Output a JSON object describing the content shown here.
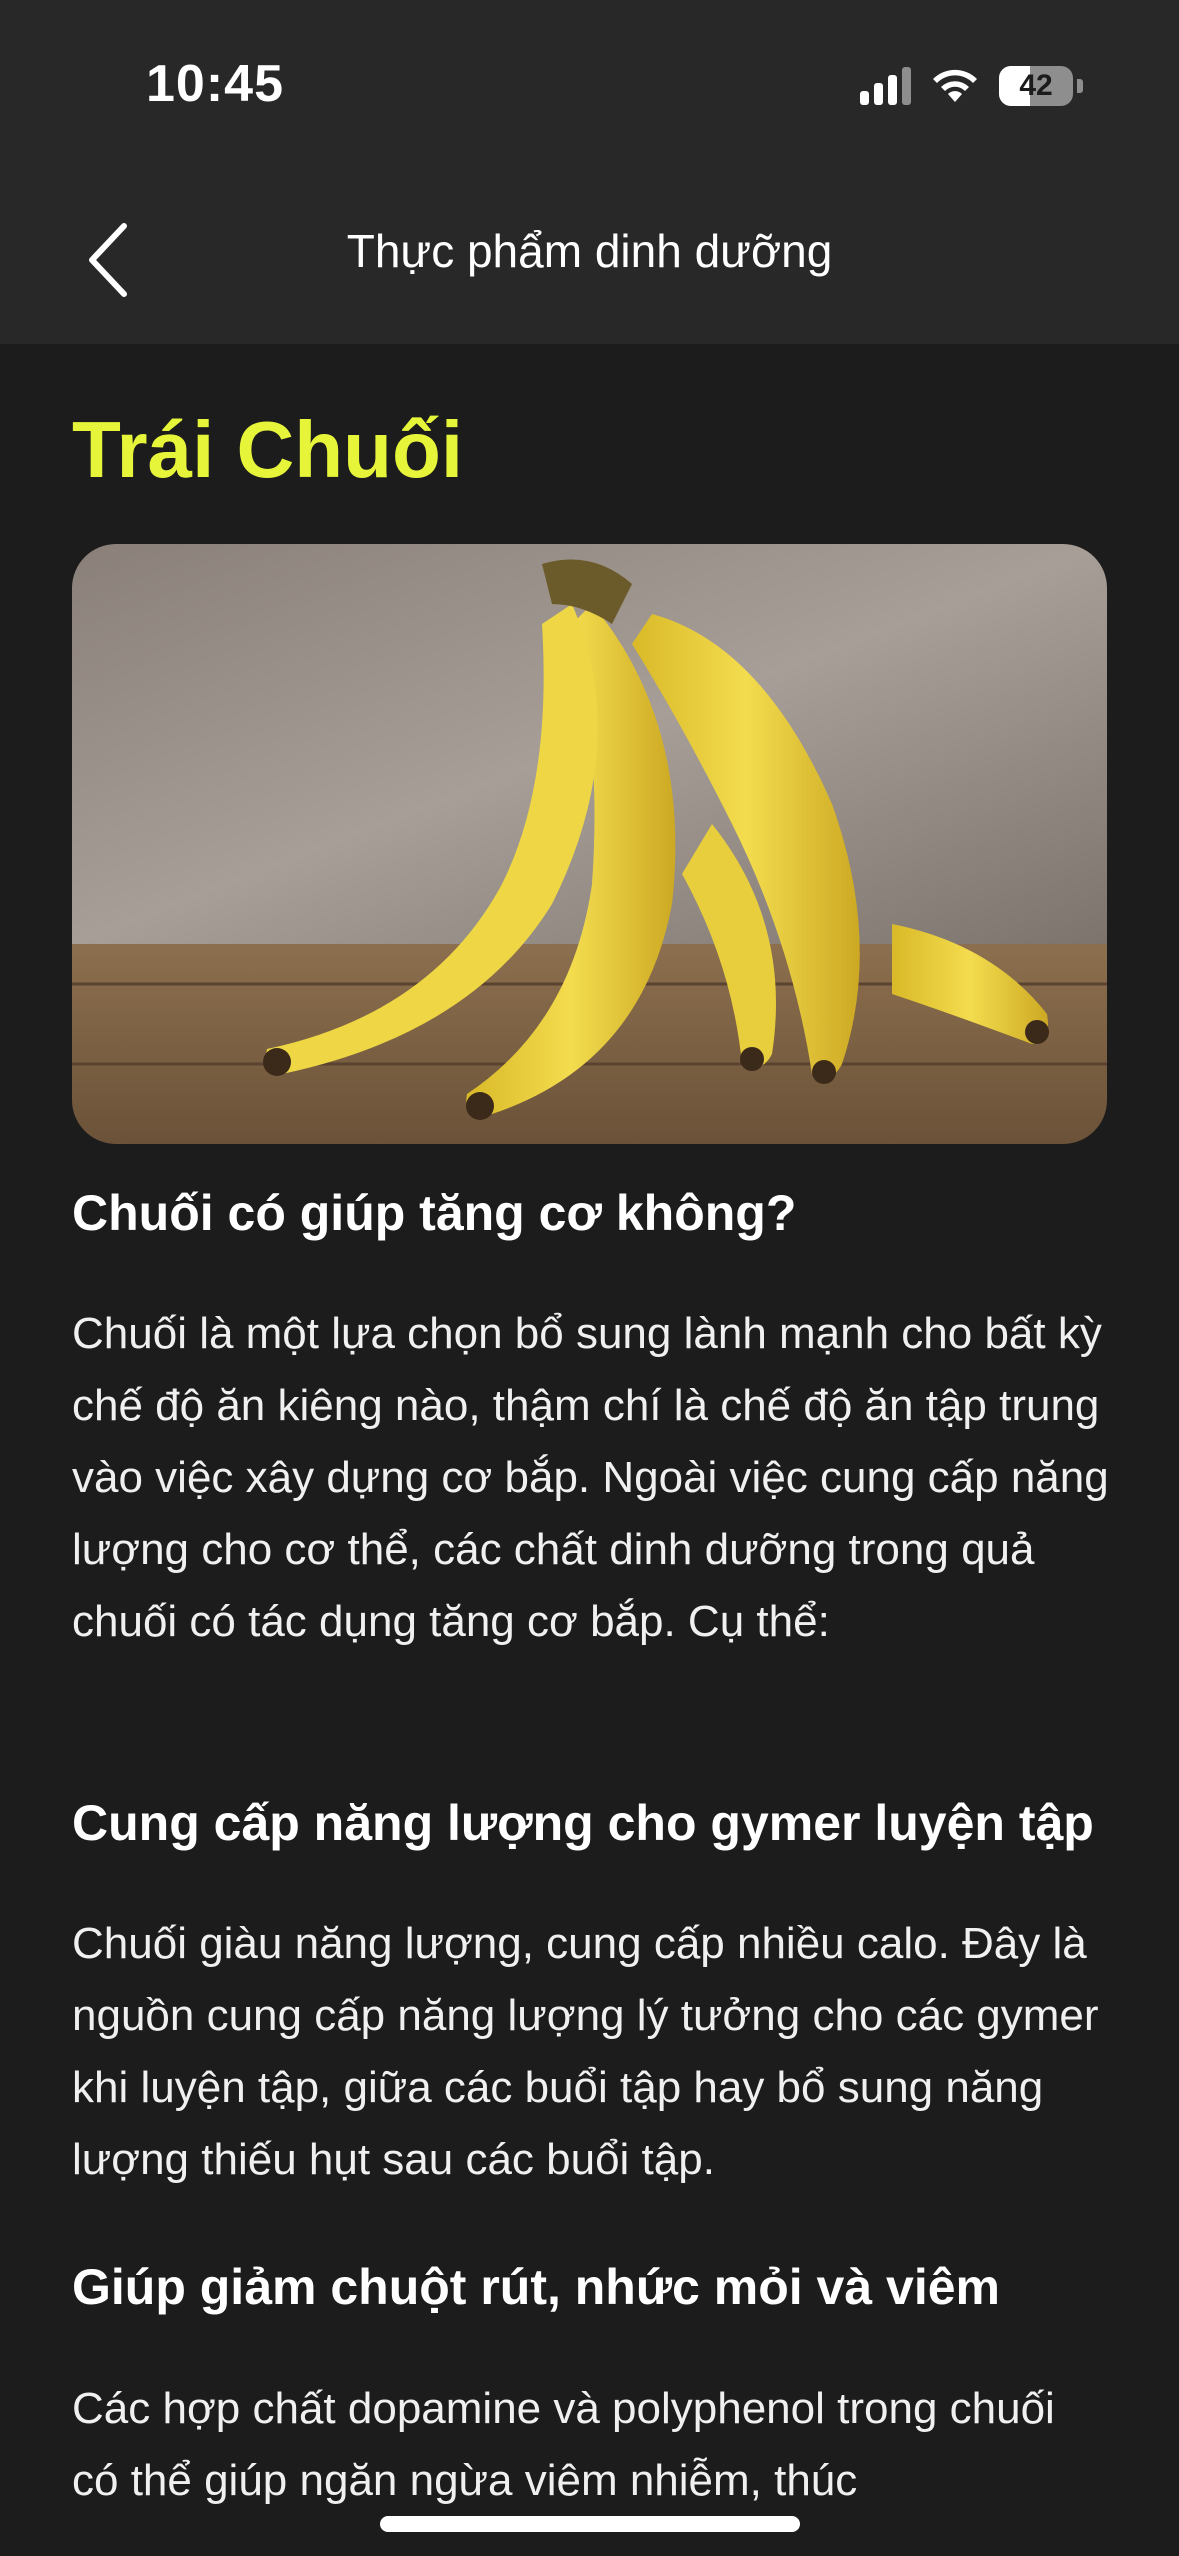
{
  "status_bar": {
    "time": "10:45",
    "battery_level": "42",
    "icons": [
      "signal-icon",
      "wifi-icon",
      "battery-icon"
    ]
  },
  "header": {
    "title": "Thực phẩm dinh dưỡng",
    "back_icon": "chevron-left-icon"
  },
  "article": {
    "title": "Trái Chuối",
    "image": "banana-photo",
    "sections": [
      {
        "heading": "Chuối có giúp tăng cơ không?",
        "body": "Chuối là một lựa chọn bổ sung lành mạnh cho bất kỳ chế độ ăn kiêng nào, thậm chí là chế độ ăn tập trung vào việc xây dựng cơ bắp. Ngoài việc cung cấp năng lượng cho cơ thể, các chất dinh dưỡng trong quả chuối có tác dụng tăng cơ bắp. Cụ thể:"
      },
      {
        "heading": "Cung cấp năng lượng cho gymer luyện tập",
        "body": "Chuối giàu năng lượng, cung cấp nhiều calo. Đây là nguồn cung cấp năng lượng lý tưởng cho các gymer khi luyện tập, giữa các buổi tập hay bổ sung năng lượng thiếu hụt sau các buổi tập."
      },
      {
        "heading": "Giúp giảm chuột rút, nhức mỏi và viêm",
        "body": "Các hợp chất dopamine và polyphenol trong chuối có thể giúp ngăn ngừa viêm nhiễm, thúc"
      }
    ]
  },
  "colors": {
    "accent": "#e6f53a",
    "header_bg": "#282828",
    "page_bg": "#1c1c1c"
  }
}
